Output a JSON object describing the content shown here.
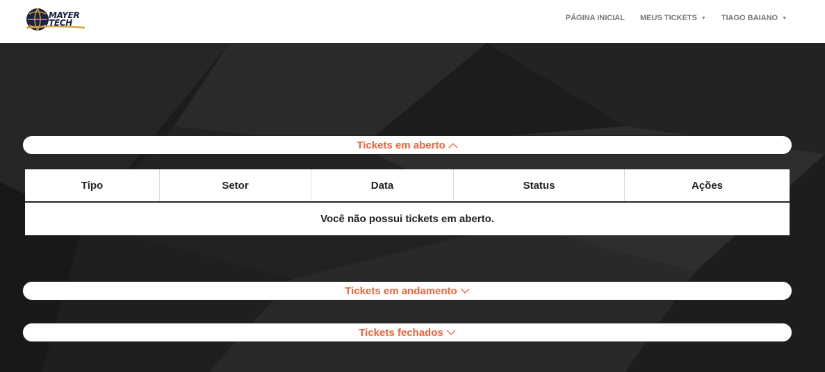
{
  "brand": {
    "line1": "MAYER",
    "line2": "TECH"
  },
  "nav": {
    "items": [
      {
        "label": "PÁGINA INICIAL",
        "dropdown": false
      },
      {
        "label": "MEUS TICKETS",
        "dropdown": true
      },
      {
        "label": "TIAGO BAIANO",
        "dropdown": true
      }
    ]
  },
  "sections": {
    "open": {
      "label": "Tickets em aberto",
      "chevron": "chevron-up-icon"
    },
    "progress": {
      "label": "Tickets em andamento",
      "chevron": "chevron-down-icon"
    },
    "closed": {
      "label": "Tickets fechados",
      "chevron": "chevron-down-icon"
    }
  },
  "table": {
    "headers": [
      "Tipo",
      "Setor",
      "Data",
      "Status",
      "Ações"
    ],
    "empty_message": "Você não possui tickets em aberto."
  },
  "colors": {
    "accent": "#e8633a",
    "background": "#1b1b1b",
    "text": "#222222"
  }
}
